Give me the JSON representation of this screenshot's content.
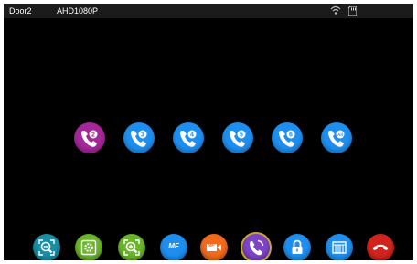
{
  "status_bar": {
    "door_label": "Door2",
    "video_format": "AHD1080P",
    "icons": [
      "wifi-icon",
      "sd-card-icon"
    ]
  },
  "call_buttons": [
    {
      "icon": "phone-icon",
      "badge": "2",
      "state": "active",
      "color": "#a5279a"
    },
    {
      "icon": "phone-icon",
      "badge": "3",
      "state": "idle",
      "color": "#1e8ff0"
    },
    {
      "icon": "phone-icon",
      "badge": "4",
      "state": "idle",
      "color": "#1e8ff0"
    },
    {
      "icon": "phone-icon",
      "badge": "5",
      "state": "idle",
      "color": "#1e8ff0"
    },
    {
      "icon": "phone-icon",
      "badge": "6",
      "state": "idle",
      "color": "#1e8ff0"
    },
    {
      "icon": "phone-icon",
      "badge": "All",
      "state": "idle",
      "color": "#1e8ff0"
    }
  ],
  "toolbar": {
    "zoom_out_icon": "zoom-out-icon",
    "settings_icon": "gear-icon",
    "zoom_in_icon": "zoom-in-icon",
    "multi_frame_label": "MF",
    "record_label": "MP",
    "intercom_icon": "phone-transfer-icon",
    "unlock_icon": "lock-icon",
    "gate_icon": "gate-icon",
    "hangup_icon": "hang-up-icon",
    "selected": "intercom"
  },
  "colors": {
    "screen_bg": "#000000",
    "call_blue": "#1e8ff0",
    "call_active": "#a5279a",
    "hangup_red": "#d2241e",
    "selected_ring": "#c7a82c"
  }
}
